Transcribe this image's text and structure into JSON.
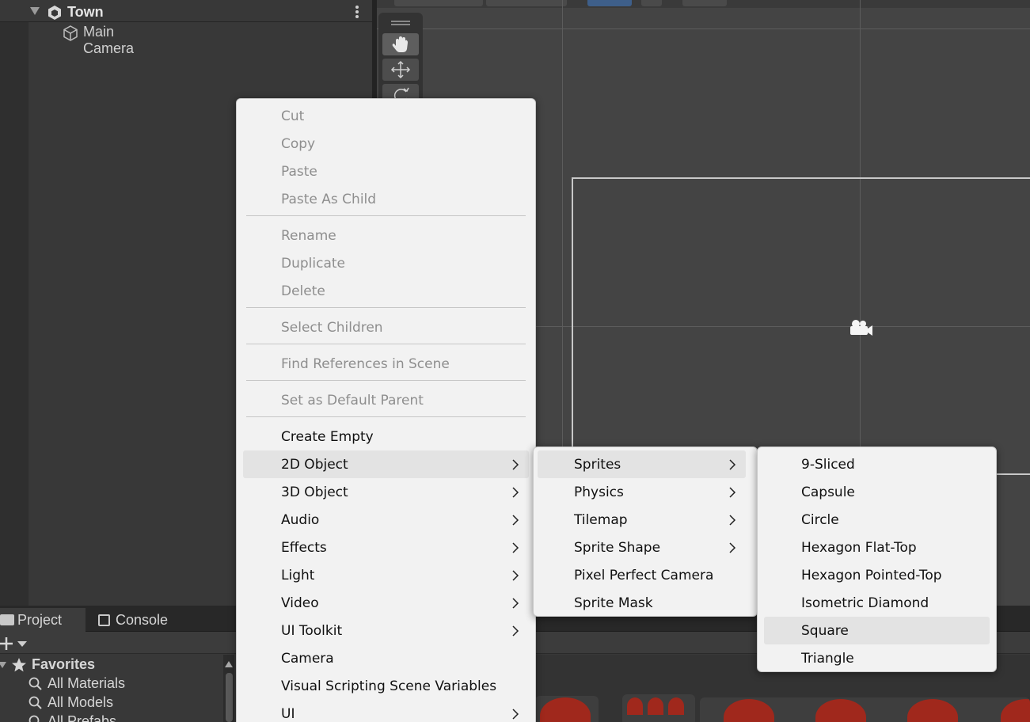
{
  "hierarchy": {
    "scene_name": "Town",
    "scene_icon": "unity-scene-icon",
    "items": [
      {
        "label": "Main Camera",
        "icon": "cube-icon"
      }
    ]
  },
  "scene_view": {
    "tools": [
      "hand-icon",
      "move-icon",
      "rotate-icon"
    ],
    "gizmo": "camera-gizmo-icon"
  },
  "context_menu": {
    "items": {
      "cut": "Cut",
      "copy": "Copy",
      "paste": "Paste",
      "paste_as_child": "Paste As Child",
      "rename": "Rename",
      "duplicate": "Duplicate",
      "delete": "Delete",
      "select_children": "Select Children",
      "find_references": "Find References in Scene",
      "set_default_parent": "Set as Default Parent",
      "create_empty": "Create Empty",
      "object_2d": "2D Object",
      "object_3d": "3D Object",
      "audio": "Audio",
      "effects": "Effects",
      "light": "Light",
      "video": "Video",
      "ui_toolkit": "UI Toolkit",
      "camera": "Camera",
      "visual_scripting": "Visual Scripting Scene Variables",
      "ui": "UI"
    },
    "highlighted": "2D Object"
  },
  "submenu_2d": {
    "items": {
      "sprites": "Sprites",
      "physics": "Physics",
      "tilemap": "Tilemap",
      "sprite_shape": "Sprite Shape",
      "pixel_perfect_camera": "Pixel Perfect Camera",
      "sprite_mask": "Sprite Mask"
    },
    "highlighted": "Sprites"
  },
  "submenu_sprites": {
    "items": {
      "nine_sliced": "9-Sliced",
      "capsule": "Capsule",
      "circle": "Circle",
      "hexagon_flat": "Hexagon Flat-Top",
      "hexagon_pointed": "Hexagon Pointed-Top",
      "isometric_diamond": "Isometric Diamond",
      "square": "Square",
      "triangle": "Triangle"
    },
    "highlighted": "Square"
  },
  "bottom_panel": {
    "tabs": {
      "project": "Project",
      "console": "Console"
    },
    "active_tab": "Project",
    "favorites": "Favorites",
    "searches": [
      "All Materials",
      "All Models",
      "All Prefabs"
    ]
  },
  "colors": {
    "menu_bg": "#f2f2f2",
    "menu_highlight": "#e3e3e3",
    "disabled_text": "#8e8e8e",
    "editor_bg": "#383838"
  }
}
